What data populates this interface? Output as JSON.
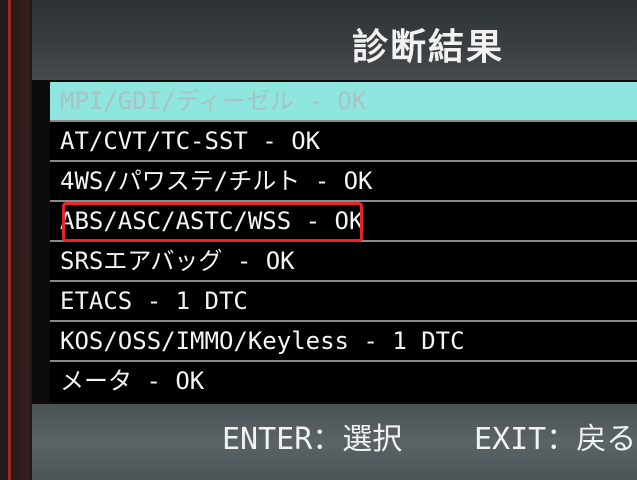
{
  "title": "診断結果",
  "items": [
    {
      "label": "MPI/GDI/ディーゼル - OK",
      "selected": true
    },
    {
      "label": "AT/CVT/TC-SST - OK",
      "selected": false
    },
    {
      "label": "4WS/パワステ/チルト - OK",
      "selected": false
    },
    {
      "label": "ABS/ASC/ASTC/WSS - OK",
      "selected": false,
      "outlined": true
    },
    {
      "label": "SRSエアバッグ - OK",
      "selected": false
    },
    {
      "label": "ETACS - 1 DTC",
      "selected": false
    },
    {
      "label": "KOS/OSS/IMMO/Keyless - 1 DTC",
      "selected": false
    },
    {
      "label": "メータ - OK",
      "selected": false
    }
  ],
  "footer": {
    "enter_hint": "ENTER：選択",
    "exit_hint": "EXIT：戻る"
  },
  "colors": {
    "selected_row": "#8fe6df",
    "outline": "#e3262a",
    "text": "#f4f4f4"
  }
}
